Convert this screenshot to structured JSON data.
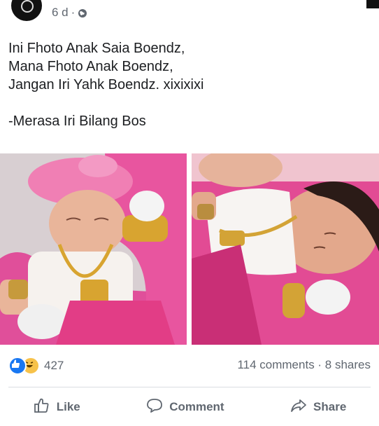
{
  "post": {
    "time": "6 d",
    "separator": "·",
    "lines": [
      "Ini Fhoto Anak Saia Boendz,",
      "Mana Fhoto Anak Boendz,",
      "Jangan Iri Yahk Boendz. xixixixi",
      "",
      "-Merasa Iri Bilang Bos"
    ]
  },
  "stats": {
    "reaction_count": "427",
    "comments_shares": "114 comments · 8 shares"
  },
  "actions": {
    "like": "Like",
    "comment": "Comment",
    "share": "Share"
  },
  "colors": {
    "like_blue": "#1877f2",
    "haha_yellow": "#f7c24a",
    "muted_text": "#606770",
    "blanket_pink": "#e04f9a"
  },
  "icons": [
    "globe-icon",
    "like-icon",
    "haha-icon",
    "thumbs-up-icon",
    "comment-icon",
    "share-icon"
  ]
}
